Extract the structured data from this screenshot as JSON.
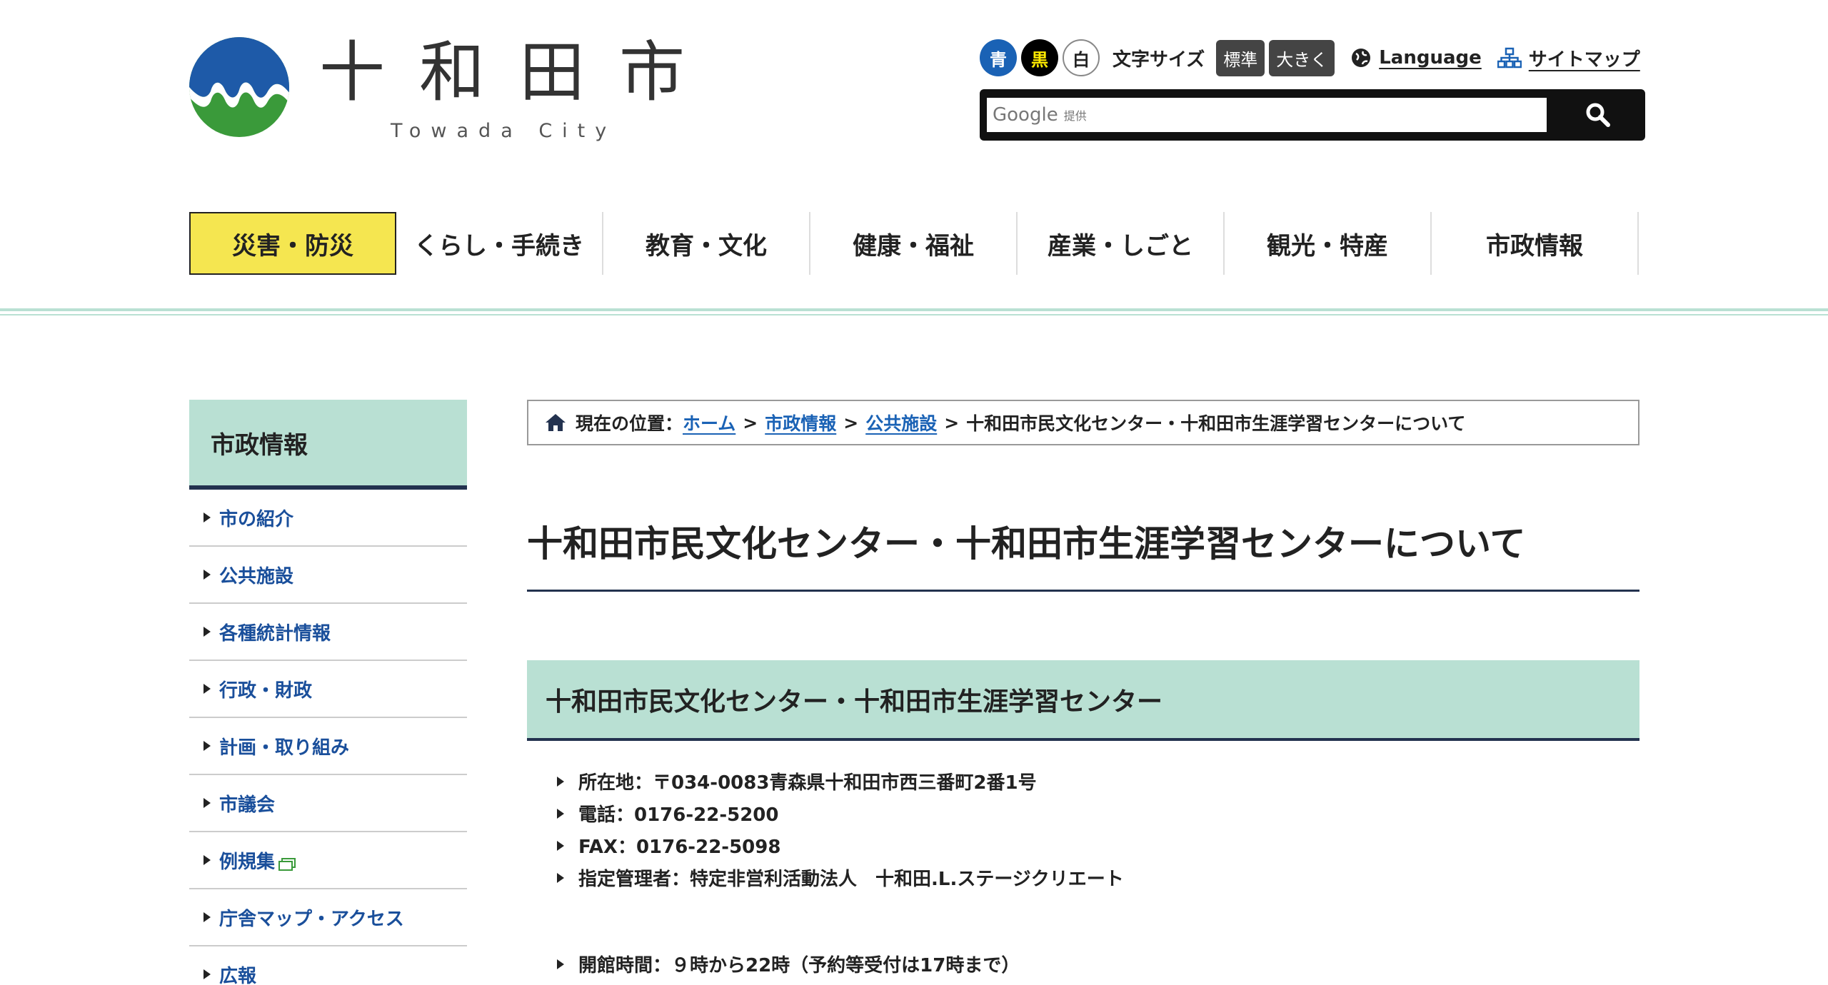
{
  "header": {
    "logo_title": "十和田市",
    "logo_sub": "Towada City",
    "color_buttons": [
      "青",
      "黒",
      "白"
    ],
    "text_size_label": "文字サイズ",
    "size_buttons": [
      "標準",
      "大きく"
    ],
    "language_link": "Language",
    "sitemap_link": "サイトマップ",
    "search_google": "Google",
    "search_provided": "提供",
    "colors": {
      "logo_blue": "#1e5aa8",
      "logo_green": "#3a9a3a",
      "accent_mint": "#b9e0d3",
      "disaster_yellow": "#f5e650"
    }
  },
  "nav": {
    "items": [
      "災害・防災",
      "くらし・手続き",
      "教育・文化",
      "健康・福祉",
      "産業・しごと",
      "観光・特産",
      "市政情報"
    ]
  },
  "sidebar": {
    "heading": "市政情報",
    "items": [
      "市の紹介",
      "公共施設",
      "各種統計情報",
      "行政・財政",
      "計画・取り組み",
      "市議会",
      "例規集",
      "庁舎マップ・アクセス",
      "広報"
    ]
  },
  "breadcrumb": {
    "label": "現在の位置：",
    "links": [
      "ホーム",
      "市政情報",
      "公共施設"
    ],
    "current": "十和田市民文化センター・十和田市生涯学習センターについて",
    "sep": ">"
  },
  "main": {
    "title": "十和田市民文化センター・十和田市生涯学習センターについて",
    "section_heading": "十和田市民文化センター・十和田市生涯学習センター",
    "info": [
      "所在地：〒034-0083青森県十和田市西三番町2番1号",
      "電話：0176-22-5200",
      "FAX：0176-22-5098",
      "指定管理者：特定非営利活動法人　十和田.L.ステージクリエート"
    ],
    "hours": "開館時間：９時から22時（予約等受付は17時まで）"
  }
}
